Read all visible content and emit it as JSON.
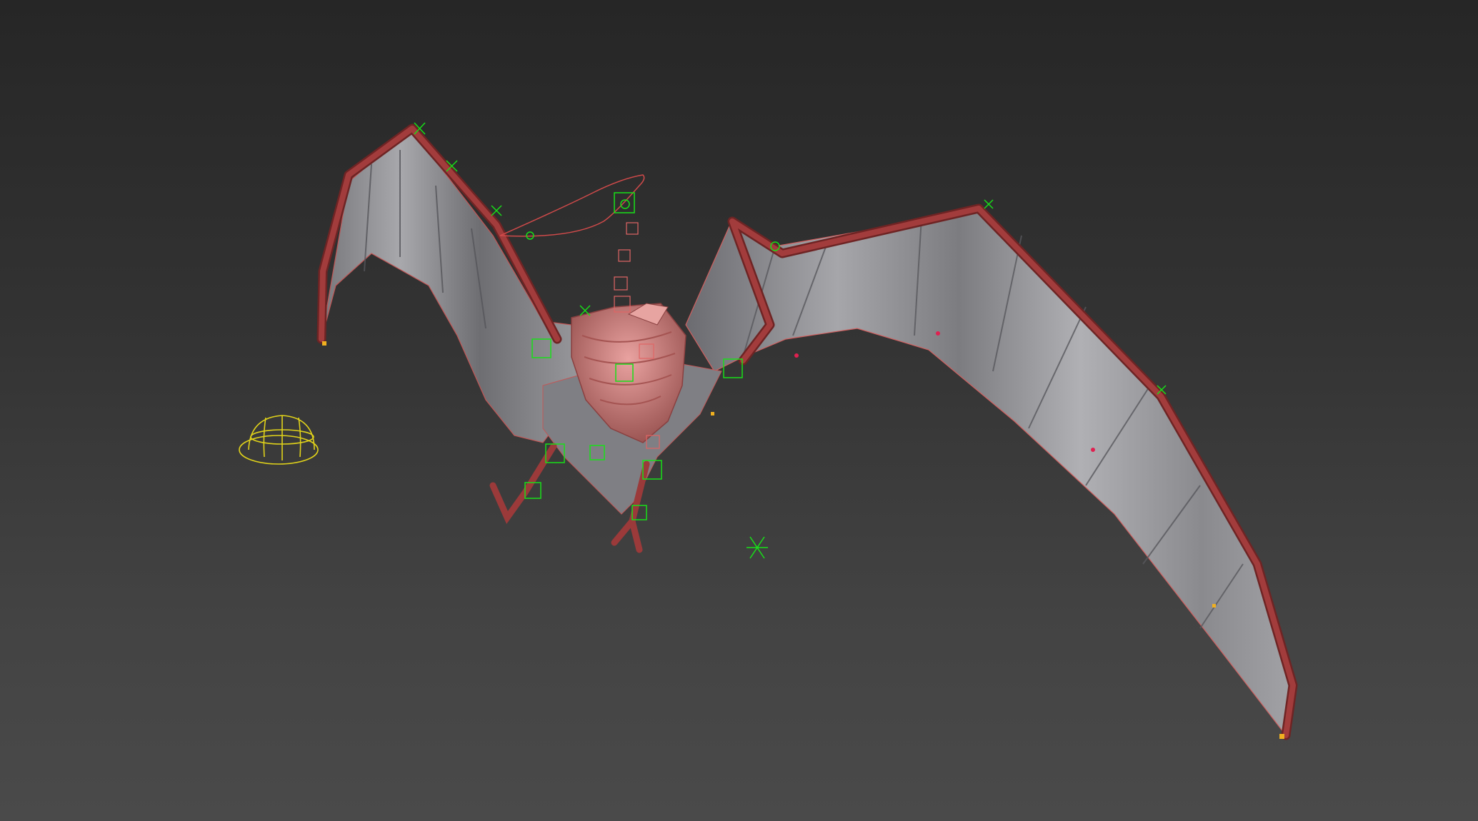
{
  "viewport": {
    "label": "",
    "background_top": "#262626",
    "background_bottom": "#4a4a4a"
  },
  "scene": {
    "subject": "rigged-bat-model",
    "colors": {
      "bone": "#9b3a3a",
      "bone_dark": "#6e2424",
      "membrane_light": "#9a9a9d",
      "membrane_dark": "#5c5c60",
      "body": "#d98a88",
      "body_dark": "#a85e5c",
      "control_green": "#18e018",
      "helper_red": "#e05a5a",
      "camera_yellow": "#e0d21a",
      "point_yellow": "#f0b020"
    },
    "icons": [
      "hard-hat-icon",
      "point-helper-icon",
      "cube-helper-icon"
    ]
  }
}
